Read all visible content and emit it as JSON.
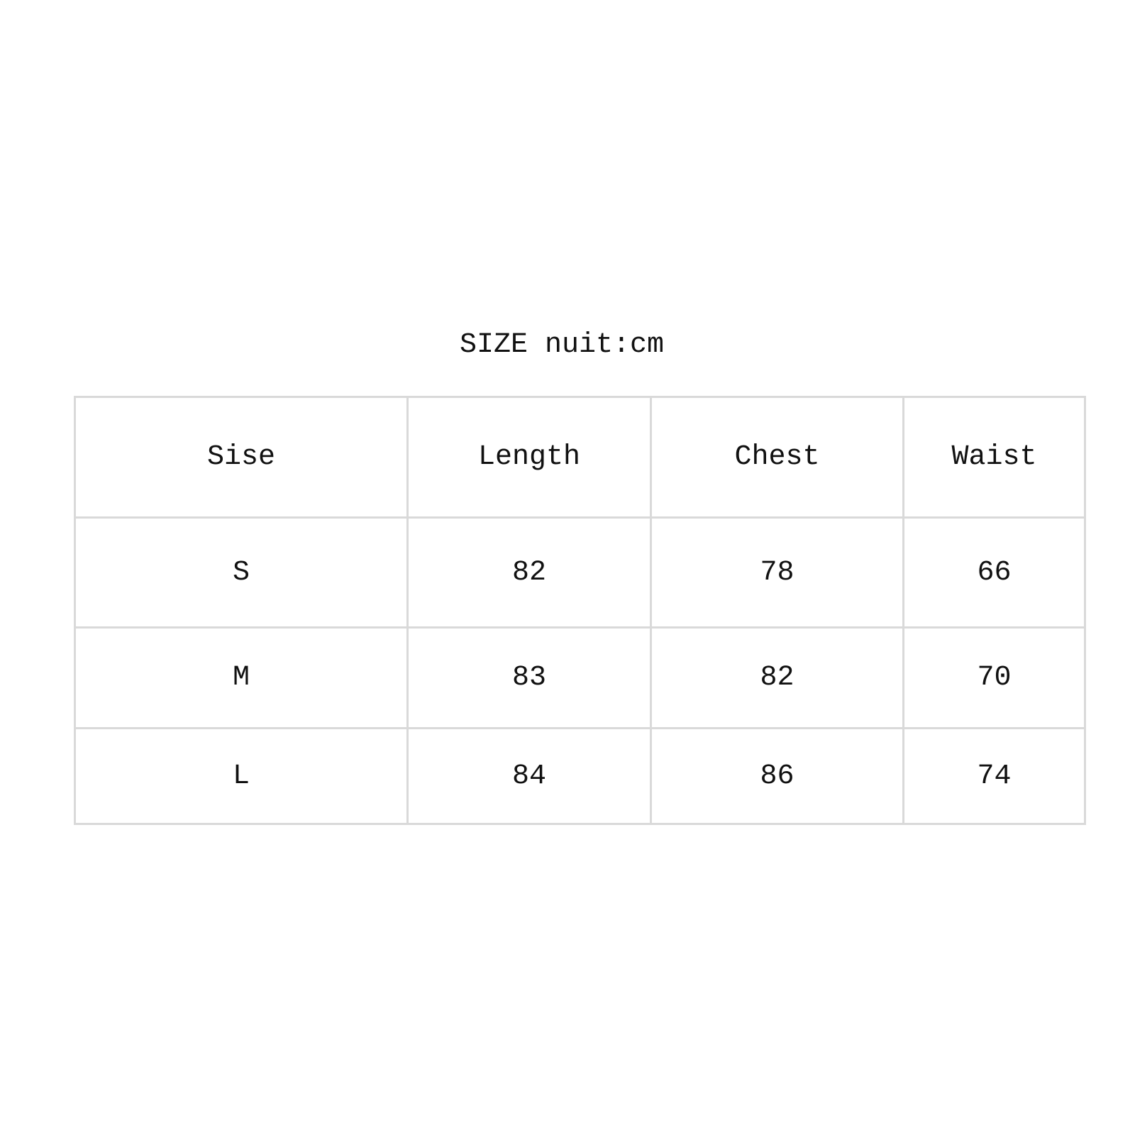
{
  "title": "SIZE nuit:cm",
  "table": {
    "headers": [
      "Sise",
      "Length",
      "Chest",
      "Waist"
    ],
    "rows": [
      [
        "S",
        "82",
        "78",
        "66"
      ],
      [
        "M",
        "83",
        "82",
        "70"
      ],
      [
        "L",
        "84",
        "86",
        "74"
      ]
    ]
  },
  "colors": {
    "background": "#ffffff",
    "border": "#d9d9d9",
    "text": "#111111"
  }
}
